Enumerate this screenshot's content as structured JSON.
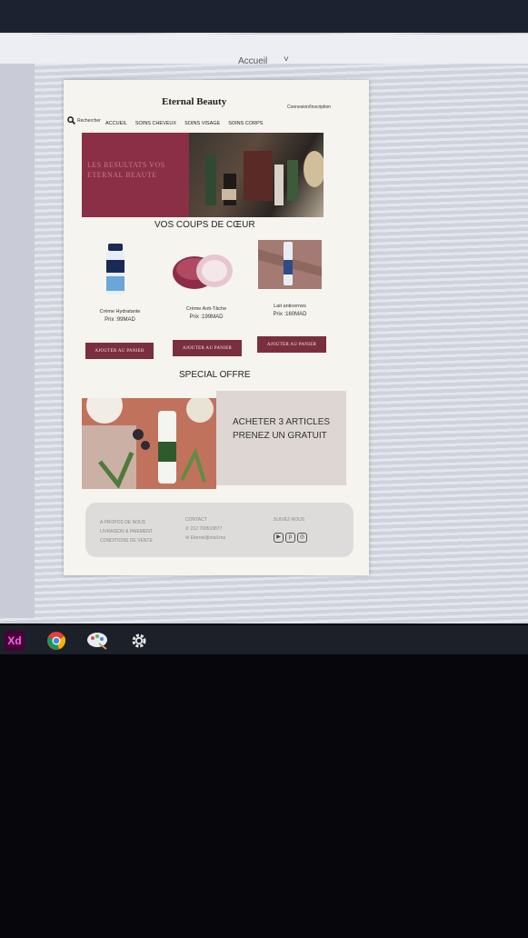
{
  "window": {
    "title": "Accueil",
    "title_suffix": "˅"
  },
  "site": {
    "brand": "Eternal Beauty",
    "login": "Connexion/Inscription",
    "search_label": "Rechercher",
    "nav": [
      "ACCUEIL",
      "SOINS CHEVEUX",
      "SOINS VISAGE",
      "SOINS CORPS"
    ],
    "hero_text": "LES RESULTATS VOS ETERNAL BEAUTE"
  },
  "favorites": {
    "title": "VOS COUPS DE CŒUR",
    "products": [
      {
        "name": "Crème Hydratante",
        "price": "Prix :99MAD",
        "button": "AJOUTER AU PANIER"
      },
      {
        "name": "Crème Anti-Tâche",
        "price": "Prix :199MAD",
        "button": "AJOUTER AU PANIER"
      },
      {
        "name": "Lait anticernes",
        "price": "Prix :160MAD",
        "button": "AJOUTER AU PANIER"
      }
    ]
  },
  "special": {
    "title": "SPECIAL OFFRE",
    "line1": "ACHETER 3 ARTICLES",
    "line2": "PRENEZ UN GRATUIT"
  },
  "footer": {
    "links": [
      "A PROPOS DE NOUS",
      "LIVRAISON & PAIEMENT",
      "CONDITIONS DE VENTE"
    ],
    "contact_title": "CONTACT",
    "phone": "212 700519877",
    "email": "Eternel@mail.ma",
    "follow_title": "SUIVEZ-NOUS",
    "social": [
      "youtube-icon",
      "pinterest-icon",
      "instagram-icon"
    ]
  },
  "taskbar": {
    "apps": [
      "Xd",
      "chrome-icon",
      "paint-icon",
      "settings-icon"
    ]
  },
  "colors": {
    "accent": "#7a2f3e",
    "hero": "#8a2f45",
    "taskbar": "#1b2029",
    "xd": "#470137"
  }
}
